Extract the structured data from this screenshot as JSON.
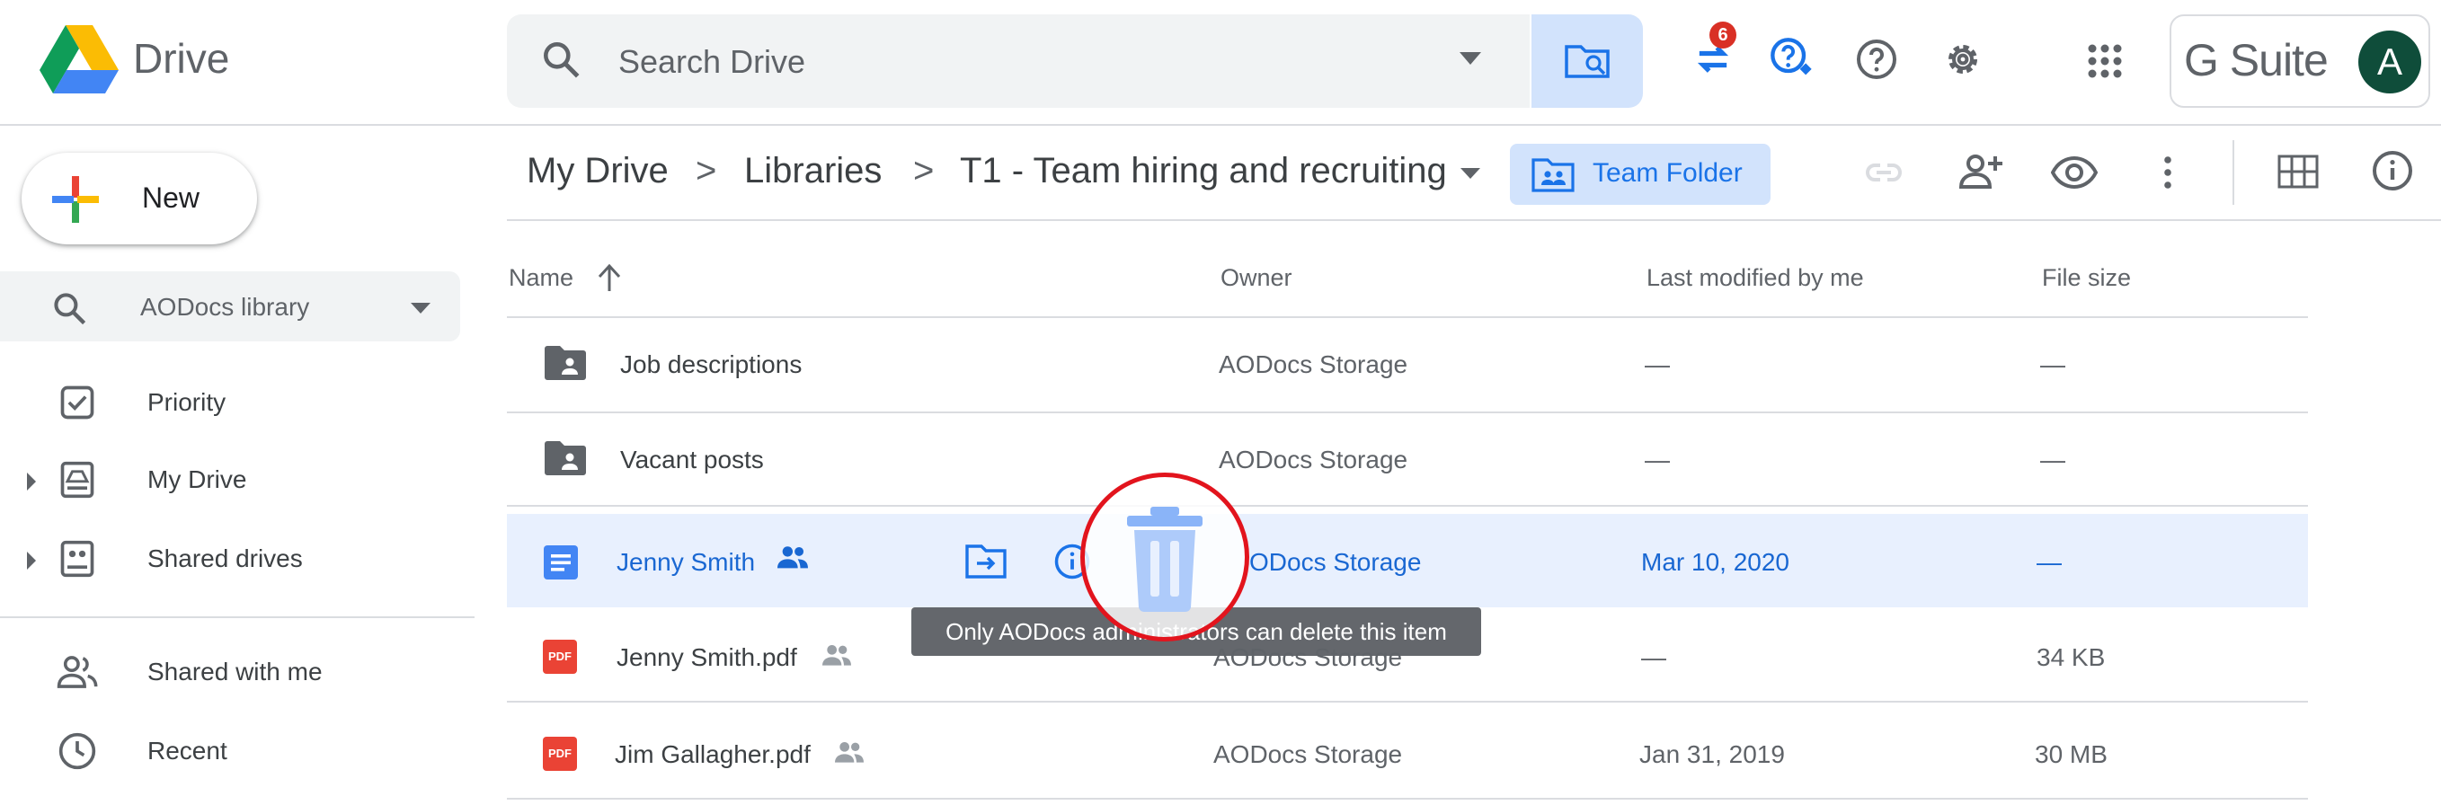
{
  "header": {
    "app_name": "Drive",
    "search_placeholder": "Search Drive",
    "sync_badge": "6",
    "gsuite_label": "G Suite",
    "avatar_initial": "A"
  },
  "sidebar": {
    "new_label": "New",
    "library_select": "AODocs library",
    "items": [
      {
        "label": "Priority",
        "icon": "checkbox-icon"
      },
      {
        "label": "My Drive",
        "icon": "my-drive-icon"
      },
      {
        "label": "Shared drives",
        "icon": "shared-drives-icon"
      },
      {
        "label": "Shared with me",
        "icon": "people-icon"
      },
      {
        "label": "Recent",
        "icon": "clock-icon"
      }
    ]
  },
  "breadcrumb": {
    "items": [
      "My Drive",
      "Libraries",
      "T1 - Team hiring and recruiting"
    ],
    "separator": ">",
    "team_folder_label": "Team Folder"
  },
  "file_list": {
    "columns": [
      "Name",
      "Owner",
      "Last modified by me",
      "File size"
    ],
    "rows": [
      {
        "name": "Job descriptions",
        "type": "shared-folder",
        "owner": "AODocs Storage",
        "modified": "—",
        "size": "—"
      },
      {
        "name": "Vacant posts",
        "type": "shared-folder",
        "owner": "AODocs Storage",
        "modified": "—",
        "size": "—"
      },
      {
        "name": "Jenny Smith",
        "type": "doc",
        "shared": true,
        "owner": "ODocs Storage",
        "modified": "Mar 10, 2020",
        "size": "—",
        "selected": true
      },
      {
        "name": "Jenny Smith.pdf",
        "type": "pdf",
        "shared": true,
        "owner": "AODocs Storage",
        "modified": "—",
        "size": "34 KB"
      },
      {
        "name": "Jim Gallagher.pdf",
        "type": "pdf",
        "shared": true,
        "owner": "AODocs Storage",
        "modified": "Jan 31, 2019",
        "size": "30 MB"
      }
    ],
    "pdf_badge": "PDF"
  },
  "tooltip": "Only AODocs administrators can delete this item",
  "colors": {
    "accent": "#1a73e8",
    "selected_row": "#e8f0fe",
    "highlight_ring": "#e2141d"
  }
}
